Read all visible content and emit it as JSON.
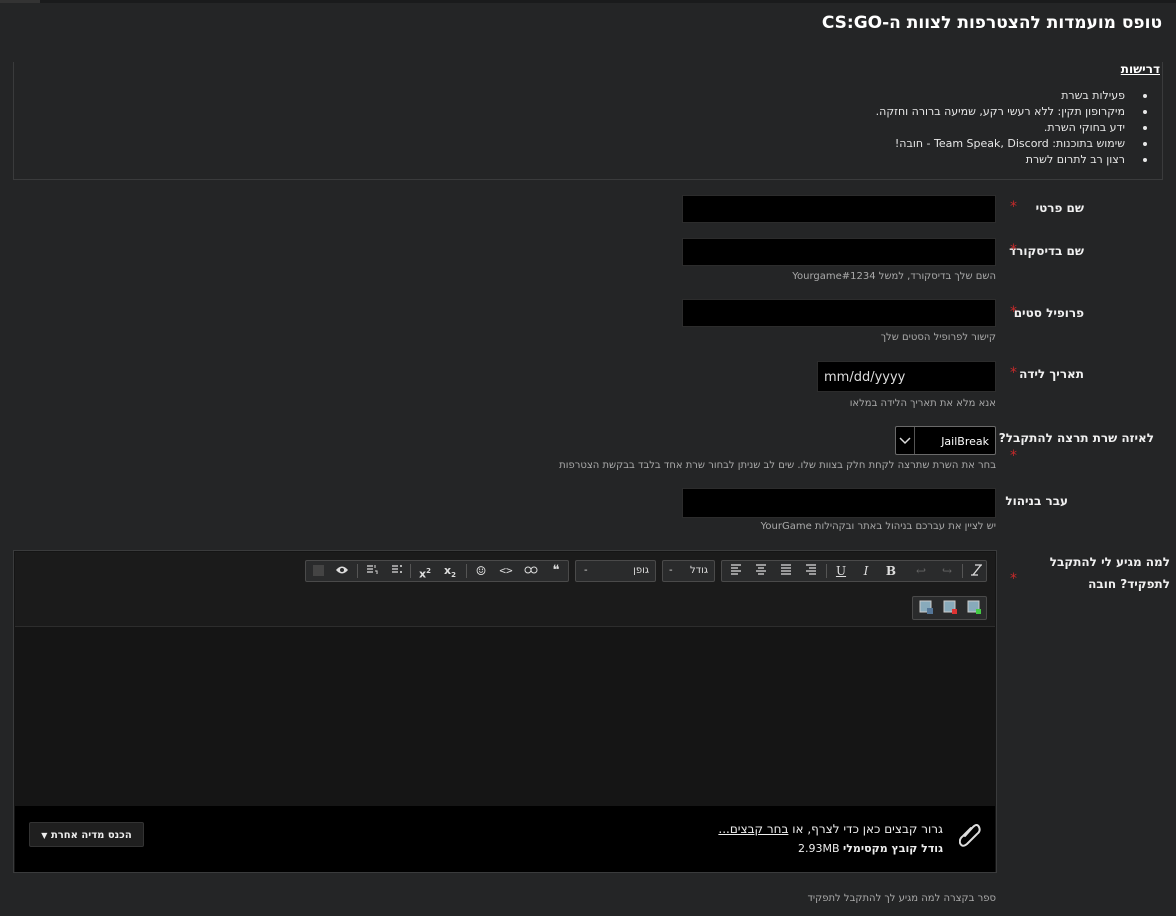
{
  "page": {
    "title": "טופס מועמדות להצטרפות לצוות ה-CS:GO"
  },
  "requirements": {
    "heading": "דרישות",
    "items": [
      "פעילות בשרת",
      "מיקרופון תקין: ללא רעשי רקע, שמיעה ברורה וחזקה.",
      "ידע בחוקי השרת.",
      "שימוש בתוכנות: Team Speak, Discord - חובה!",
      "רצון רב לתרום לשרת"
    ]
  },
  "fields": {
    "first_name": {
      "label": "שם פרטי",
      "required": "*",
      "value": ""
    },
    "discord": {
      "label": "שם בדיסקורד",
      "required": "*",
      "value": "",
      "hint": "השם שלך בדיסקורד, למשל Yourgame#1234"
    },
    "steam": {
      "label": "פרופיל סטים",
      "required": "*",
      "value": "",
      "hint": "קישור לפרופיל הסטים שלך"
    },
    "birthdate": {
      "label": "תאריך לידה",
      "required": "*",
      "placeholder": "mm/dd/yyyy",
      "hint": "אנא מלא את תאריך הלידה במלאו"
    },
    "server": {
      "label": "לאיזה שרת תרצה להתקבל?",
      "required": "*",
      "selected": "JailBreak",
      "hint": "בחר את השרת שתרצה לקחת חלק בצוות שלו.  שים לב שניתן לבחור שרת אחד בלבד בבקשת הצטרפות"
    },
    "management": {
      "label": "עבר בניהול",
      "value": "",
      "hint": "יש לציין את עברכם בניהול באתר ובקהילות YourGame"
    },
    "why": {
      "label": "למה מגיע לי להתקבל לתפקיד? חובה",
      "required": "*",
      "hint": "ספר בקצרה למה מגיע לך להתקבל לתפקיד"
    }
  },
  "editor": {
    "font_label": "גופן",
    "size_label": "גודל",
    "dropdown_placeholder": "-",
    "attach_text": "גרור קבצים כאן כדי לצרף, או ",
    "attach_link": "בחר קבצים...",
    "max_label": "גודל קובץ מקסימלי",
    "max_value": "2.93MB",
    "media_button": "הכנס מדיה אחרת"
  },
  "colors": {
    "background": "#242526",
    "input": "#000000",
    "required_star": "#c62a2a"
  }
}
